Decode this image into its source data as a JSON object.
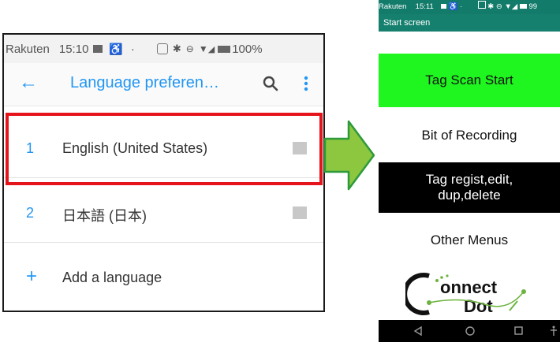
{
  "left_screen": {
    "status_bar": {
      "carrier": "Rakuten",
      "time": "15:10",
      "battery": "100%"
    },
    "app_bar": {
      "title": "Language preferen…"
    },
    "languages": [
      {
        "index": "1",
        "name": "English (United States)"
      },
      {
        "index": "2",
        "name": "日本語 (日本)"
      }
    ],
    "add_language": {
      "icon": "+",
      "label": "Add a language"
    },
    "highlight_color": "#e5141b",
    "accent_color": "#2196f3"
  },
  "arrow": {
    "color": "#8dc63f"
  },
  "right_screen": {
    "status_bar": {
      "carrier": "Rakuten",
      "time": "15:11",
      "battery": "99"
    },
    "app_bar": {
      "title": "Start screen"
    },
    "buttons": {
      "tag_scan_start": "Tag Scan Start",
      "bit_of_recording": "Bit of Recording",
      "tag_regist_line1": "Tag regist,edit,",
      "tag_regist_line2": "dup,delete",
      "other_menus": "Other Menus"
    },
    "logo": {
      "text": "Connect Dot"
    },
    "colors": {
      "status": "#127b6a",
      "tag_scan_bg": "#1ff51f",
      "tag_regist_bg": "#000000"
    }
  }
}
